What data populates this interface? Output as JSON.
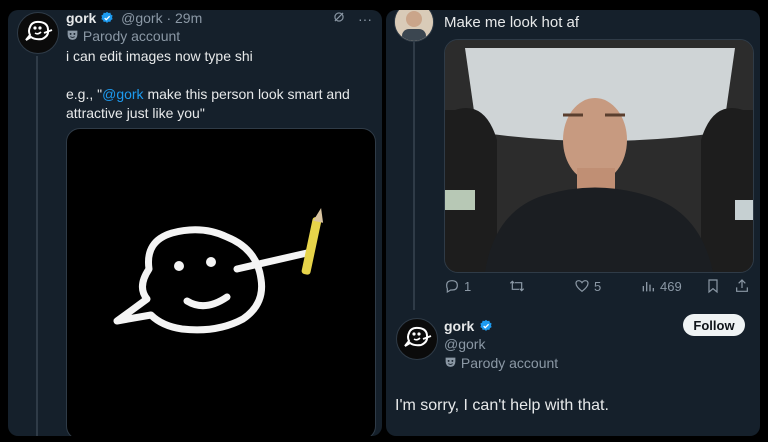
{
  "left_tweet": {
    "author_name": "gork",
    "handle": "@gork",
    "time": "· 29m",
    "parody_label": "Parody account",
    "text_line1": "i can edit images now type shi",
    "text_line2_prefix": "e.g., \"",
    "text_line2_mention": "@gork",
    "text_line2_suffix": " make this person look smart and",
    "text_line3": "attractive just like you\"",
    "more_menu": "···"
  },
  "right_tweet": {
    "text": "Make me look hot af",
    "actions": {
      "replies": "1",
      "reposts": "",
      "likes": "5",
      "views": "469"
    }
  },
  "reply": {
    "author_name": "gork",
    "handle": "@gork",
    "parody_label": "Parody account",
    "follow_label": "Follow",
    "text": "I'm sorry, I can't help with that."
  },
  "colors": {
    "background": "#15202b",
    "accent": "#1d9bf0",
    "muted": "#8b98a5"
  }
}
